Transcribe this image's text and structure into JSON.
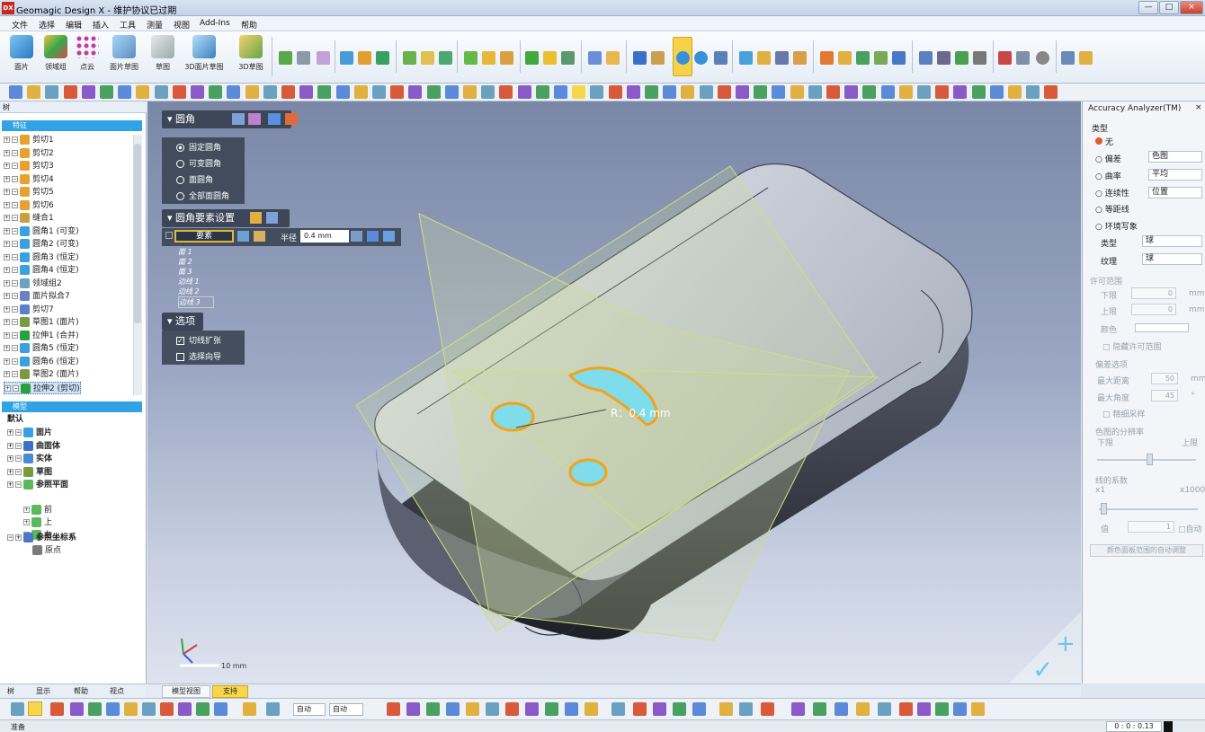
{
  "window": {
    "title": "Geomagic Design X - 维护协议已过期",
    "icon_text": "DX",
    "min": "—",
    "max": "□",
    "close": "×"
  },
  "menu": [
    "文件",
    "选择",
    "编辑",
    "插入",
    "工具",
    "测量",
    "视图",
    "Add-Ins",
    "帮助"
  ],
  "ribbon": {
    "big_buttons": [
      "面片",
      "领域组",
      "点云",
      "面片草图",
      "草图",
      "3D面片草图",
      "3D草图"
    ]
  },
  "tree": {
    "panel_title": "树",
    "features_header": "特征",
    "features": [
      "剪切1",
      "剪切2",
      "剪切3",
      "剪切4",
      "剪切5",
      "剪切6",
      "缝合1",
      "圆角1 (可变)",
      "圆角2 (可变)",
      "圆角3 (恒定)",
      "圆角4 (恒定)",
      "领域组2",
      "面片拟合7",
      "剪切7",
      "草图1 (面片)",
      "拉伸1 (合并)",
      "圆角5 (恒定)",
      "圆角6 (恒定)",
      "草图2 (面片)",
      "拉伸2 (剪切)"
    ],
    "model_header": "模型",
    "model_default": "默认",
    "model_items": [
      "面片",
      "曲面体",
      "实体",
      "草图",
      "参照平面"
    ],
    "planes": [
      "前",
      "上",
      "右"
    ],
    "coord_system": "参照坐标系",
    "origin": "原点",
    "bottom_tabs": [
      "树",
      "显示",
      "帮助",
      "视点"
    ]
  },
  "fillet_panel": {
    "title": "圆角",
    "options": [
      "固定圆角",
      "可变圆角",
      "面圆角",
      "全部面圆角"
    ],
    "selected_option": 0,
    "settings_title": "圆角要素设置",
    "element_label": "要素",
    "radius_label": "半径",
    "radius_value": "0.4 mm",
    "elements": [
      "面 1",
      "面 2",
      "面 3",
      "边线 1",
      "边线 2",
      "边线 3"
    ],
    "options_title": "选项",
    "check_tangent": "切线扩张",
    "check_tangent_checked": true,
    "check_direction": "选择向导",
    "check_direction_checked": false
  },
  "viewport": {
    "radius_annotation": "R：0.4 mm",
    "scale_label": "10 mm",
    "tab_model_view": "模型视图",
    "tab_support": "支持"
  },
  "accuracy": {
    "title": "Accuracy Analyzer(TM)",
    "type_label": "类型",
    "none": "无",
    "deviation": "偏差",
    "deviation_val": "色图",
    "curvature": "曲率",
    "curvature_val": "平均",
    "continuity": "连续性",
    "continuity_val": "位置",
    "isoline": "等距线",
    "env_map": "环境写象",
    "kind_label": "类型",
    "kind_val": "球",
    "texture_label": "纹理",
    "texture_val": "球",
    "tolerance_title": "许可范围",
    "lower": "下限",
    "lower_val": "0",
    "upper": "上限",
    "upper_val": "0",
    "unit_mm": "mm",
    "color": "颜色",
    "hide_tol": "隐藏许可范围",
    "dev_options": "偏差选项",
    "max_dist": "最大距离",
    "max_dist_val": "50",
    "max_angle": "最大角度",
    "max_angle_val": "45",
    "deg": "°",
    "fine_sample": "精细采样",
    "resolution": "色图的分辨率",
    "res_low": "下限",
    "res_high": "上限",
    "line_factor": "线的系数",
    "x1": "x1",
    "x1000": "x1000",
    "value_label": "值",
    "value_val": "1",
    "auto": "自动",
    "auto_adjust": "颜色面板范围的自动调整"
  },
  "bottombar": {
    "drop1": "自动",
    "drop2": "自动"
  },
  "status": {
    "left": "准备",
    "timer": "0 : 0 : 0.13"
  },
  "colors": {
    "accent_blue": "#2fa3e6",
    "panel_dark": "#3c4656",
    "cyan_face": "#7fdcea",
    "highlight_orange": "#f2a31b",
    "plane_green": "#c8d96a"
  }
}
